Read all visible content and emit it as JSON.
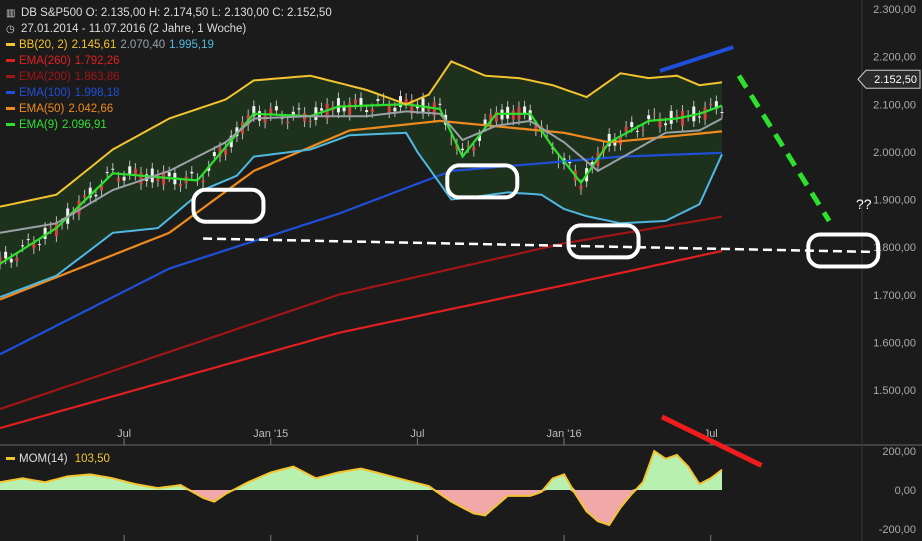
{
  "header": {
    "symbol_line": "DB S&P500   O: 2.135,00   H: 2.174,50   L: 2.130,00   C: 2.152,50",
    "range_line": "27.01.2014 - 11.07.2016 (2 Jahre, 1 Woche)"
  },
  "legend": [
    {
      "label": "BB(20, 2)",
      "values": [
        "2.145,61",
        "2.070,40",
        "1.995,19"
      ],
      "colors": [
        "#f4c430",
        "#9aa0a6",
        "#4fb8e0"
      ]
    },
    {
      "label": "EMA(260)",
      "values": [
        "1.792,26"
      ],
      "colors": [
        "#e02020"
      ]
    },
    {
      "label": "EMA(200)",
      "values": [
        "1.863,86"
      ],
      "colors": [
        "#a01515"
      ]
    },
    {
      "label": "EMA(100)",
      "values": [
        "1.998,18"
      ],
      "colors": [
        "#1f4fd8"
      ]
    },
    {
      "label": "EMA(50)",
      "values": [
        "2.042,66"
      ],
      "colors": [
        "#f08a1e"
      ]
    },
    {
      "label": "EMA(9)",
      "values": [
        "2.096,91"
      ],
      "colors": [
        "#2ee02e"
      ]
    }
  ],
  "price_badge": "2.152,50",
  "question_marks": "??",
  "mom_legend": {
    "label": "MOM(14)",
    "value": "103,50",
    "color": "#f4c430"
  },
  "chart_data": [
    {
      "type": "line",
      "title": "DB S&P500",
      "ylim": [
        1420,
        2320
      ],
      "y_ticks": [
        "2.300,00",
        "2.200,00",
        "2.100,00",
        "2.000,00",
        "1.900,00",
        "1.800,00",
        "1.700,00",
        "1.600,00",
        "1.500,00"
      ],
      "y_tick_values": [
        2300,
        2200,
        2100,
        2000,
        1900,
        1800,
        1700,
        1600,
        1500
      ],
      "x_ticks": [
        "Jul",
        "Jan '15",
        "Jul",
        "Jan '16",
        "Jul"
      ],
      "x_tick_weeks": [
        22,
        48,
        74,
        100,
        126
      ],
      "weeks": 129,
      "last_close": 2152.5,
      "series": [
        {
          "name": "EMA(260)",
          "color": "#e02020",
          "anchors": [
            [
              0,
              1420
            ],
            [
              60,
              1620
            ],
            [
              100,
              1720
            ],
            [
              128,
              1792
            ]
          ]
        },
        {
          "name": "EMA(200)",
          "color": "#a01515",
          "anchors": [
            [
              0,
              1460
            ],
            [
              60,
              1700
            ],
            [
              100,
              1808
            ],
            [
              128,
              1864
            ]
          ]
        },
        {
          "name": "EMA(100)",
          "color": "#1f4fd8",
          "anchors": [
            [
              0,
              1575
            ],
            [
              30,
              1755
            ],
            [
              60,
              1870
            ],
            [
              80,
              1960
            ],
            [
              110,
              1990
            ],
            [
              128,
              1998
            ]
          ]
        },
        {
          "name": "EMA(50)",
          "color": "#f08a1e",
          "anchors": [
            [
              0,
              1690
            ],
            [
              30,
              1830
            ],
            [
              45,
              1960
            ],
            [
              62,
              2045
            ],
            [
              78,
              2065
            ],
            [
              100,
              2040
            ],
            [
              108,
              2020
            ],
            [
              128,
              2043
            ]
          ]
        },
        {
          "name": "EMA(9)",
          "color": "#2ee02e",
          "anchors": [
            [
              0,
              1765
            ],
            [
              10,
              1840
            ],
            [
              20,
              1955
            ],
            [
              35,
              1940
            ],
            [
              45,
              2080
            ],
            [
              55,
              2075
            ],
            [
              60,
              2095
            ],
            [
              72,
              2100
            ],
            [
              78,
              2090
            ],
            [
              82,
              1990
            ],
            [
              88,
              2080
            ],
            [
              94,
              2080
            ],
            [
              98,
              2010
            ],
            [
              103,
              1935
            ],
            [
              108,
              2020
            ],
            [
              115,
              2065
            ],
            [
              120,
              2070
            ],
            [
              124,
              2080
            ],
            [
              128,
              2097
            ]
          ]
        },
        {
          "name": "BB(20, 2) upper",
          "color": "#f4c430",
          "anchors": [
            [
              0,
              1885
            ],
            [
              10,
              1910
            ],
            [
              20,
              2005
            ],
            [
              30,
              2070
            ],
            [
              40,
              2110
            ],
            [
              45,
              2150
            ],
            [
              55,
              2160
            ],
            [
              65,
              2130
            ],
            [
              72,
              2100
            ],
            [
              76,
              2120
            ],
            [
              80,
              2190
            ],
            [
              86,
              2160
            ],
            [
              92,
              2155
            ],
            [
              98,
              2140
            ],
            [
              104,
              2115
            ],
            [
              110,
              2165
            ],
            [
              115,
              2155
            ],
            [
              120,
              2160
            ],
            [
              124,
              2140
            ],
            [
              128,
              2146
            ]
          ]
        },
        {
          "name": "BB(20, 2) middle",
          "color": "#9aa0a6",
          "anchors": [
            [
              0,
              1830
            ],
            [
              10,
              1850
            ],
            [
              20,
              1920
            ],
            [
              30,
              1960
            ],
            [
              40,
              2020
            ],
            [
              45,
              2070
            ],
            [
              55,
              2075
            ],
            [
              65,
              2075
            ],
            [
              72,
              2085
            ],
            [
              78,
              2080
            ],
            [
              82,
              2025
            ],
            [
              88,
              2055
            ],
            [
              94,
              2065
            ],
            [
              100,
              2020
            ],
            [
              106,
              1960
            ],
            [
              112,
              2000
            ],
            [
              118,
              2040
            ],
            [
              124,
              2045
            ],
            [
              128,
              2070
            ]
          ]
        },
        {
          "name": "BB(20, 2) lower",
          "color": "#4fb8e0",
          "anchors": [
            [
              0,
              1695
            ],
            [
              10,
              1740
            ],
            [
              20,
              1830
            ],
            [
              28,
              1840
            ],
            [
              36,
              1920
            ],
            [
              42,
              1950
            ],
            [
              45,
              1990
            ],
            [
              55,
              2005
            ],
            [
              62,
              2035
            ],
            [
              72,
              2040
            ],
            [
              74,
              2000
            ],
            [
              80,
              1900
            ],
            [
              84,
              1905
            ],
            [
              90,
              1915
            ],
            [
              96,
              1910
            ],
            [
              100,
              1880
            ],
            [
              104,
              1865
            ],
            [
              110,
              1850
            ],
            [
              118,
              1855
            ],
            [
              124,
              1890
            ],
            [
              128,
              1995
            ]
          ]
        }
      ],
      "annotations": {
        "support_line": {
          "from": [
            36,
            1818
          ],
          "to": [
            128,
            1790
          ],
          "color": "#ffffff",
          "style": "dashed"
        },
        "up_trend": {
          "from": [
            117,
            2170
          ],
          "to": [
            130,
            2220
          ],
          "color": "#1f4fd8"
        },
        "projection": {
          "from": [
            131,
            2160
          ],
          "to": [
            147,
            1855
          ],
          "color": "#2ee02e",
          "style": "dashed"
        },
        "circles": [
          [
            40.5,
            1887
          ],
          [
            85.5,
            1938
          ],
          [
            107,
            1812
          ],
          [
            149.5,
            1793
          ]
        ]
      }
    },
    {
      "type": "area",
      "title": "MOM(14)",
      "ylim": [
        -250,
        250
      ],
      "y_ticks": [
        "200,00",
        "0,00",
        "-200,00"
      ],
      "y_tick_values": [
        200,
        0,
        -200
      ],
      "last_value": 103.5,
      "anchors": [
        [
          0,
          40
        ],
        [
          4,
          60
        ],
        [
          8,
          40
        ],
        [
          12,
          70
        ],
        [
          16,
          80
        ],
        [
          20,
          60
        ],
        [
          24,
          30
        ],
        [
          28,
          10
        ],
        [
          32,
          25
        ],
        [
          36,
          -40
        ],
        [
          38,
          -60
        ],
        [
          40,
          -20
        ],
        [
          44,
          40
        ],
        [
          48,
          90
        ],
        [
          52,
          120
        ],
        [
          56,
          60
        ],
        [
          60,
          90
        ],
        [
          64,
          110
        ],
        [
          68,
          80
        ],
        [
          72,
          50
        ],
        [
          76,
          20
        ],
        [
          80,
          -60
        ],
        [
          84,
          -120
        ],
        [
          86,
          -130
        ],
        [
          88,
          -80
        ],
        [
          90,
          -30
        ],
        [
          94,
          -30
        ],
        [
          96,
          -10
        ],
        [
          98,
          60
        ],
        [
          100,
          80
        ],
        [
          102,
          -20
        ],
        [
          104,
          -110
        ],
        [
          106,
          -160
        ],
        [
          108,
          -180
        ],
        [
          110,
          -90
        ],
        [
          112,
          -20
        ],
        [
          114,
          40
        ],
        [
          116,
          200
        ],
        [
          118,
          160
        ],
        [
          120,
          180
        ],
        [
          122,
          120
        ],
        [
          124,
          30
        ],
        [
          126,
          60
        ],
        [
          128,
          104
        ]
      ],
      "annotations": {
        "divergence": {
          "from": [
            117,
            170
          ],
          "to": [
            135,
            100
          ],
          "color": "#ee1c1c"
        }
      }
    }
  ]
}
